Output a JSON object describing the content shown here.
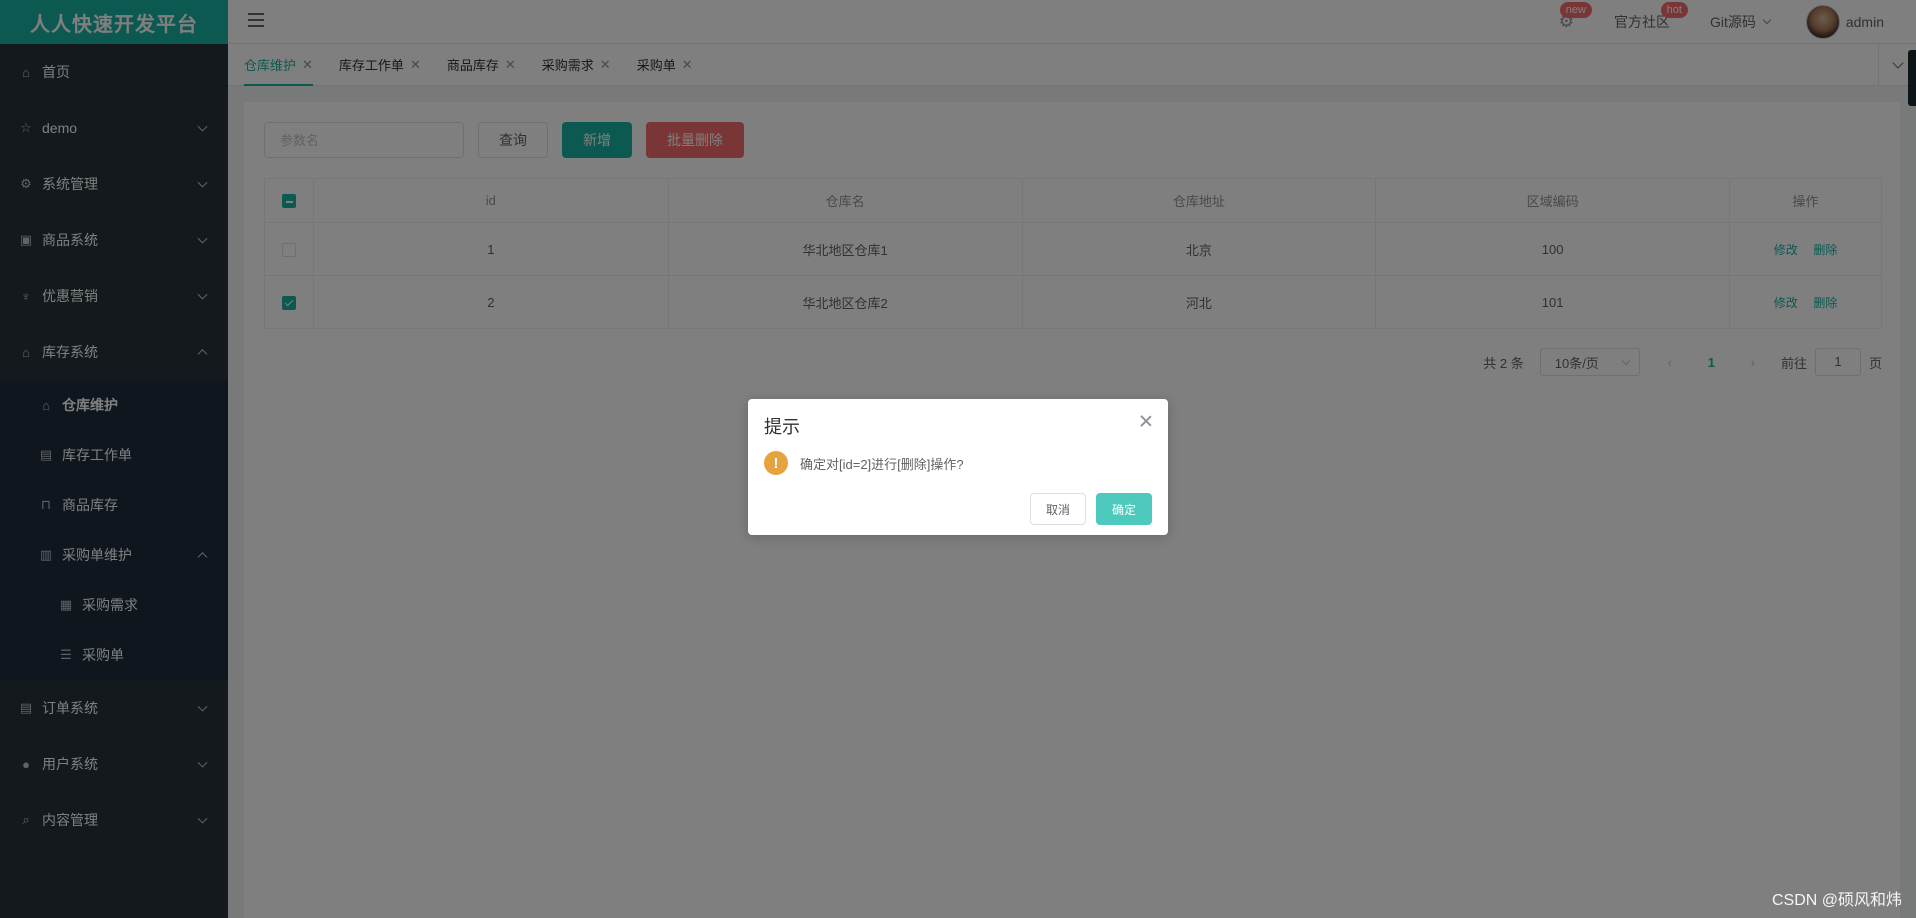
{
  "brand": "人人快速开发平台",
  "sidebar": {
    "items": [
      {
        "label": "首页",
        "icon": "home-icon"
      },
      {
        "label": "demo",
        "icon": "star-icon"
      },
      {
        "label": "系统管理",
        "icon": "gear-icon"
      },
      {
        "label": "商品系统",
        "icon": "box-icon"
      },
      {
        "label": "优惠营销",
        "icon": "coupon-icon"
      },
      {
        "label": "库存系统",
        "icon": "home-icon",
        "expanded": true
      }
    ],
    "inventory_sub": [
      {
        "label": "仓库维护",
        "icon": "home-icon",
        "active": true
      },
      {
        "label": "库存工作单",
        "icon": "document-icon"
      },
      {
        "label": "商品库存",
        "icon": "lock-icon"
      },
      {
        "label": "采购单维护",
        "icon": "bar-chart-icon",
        "expanded": true
      }
    ],
    "purchase_sub": [
      {
        "label": "采购需求",
        "icon": "grid-icon"
      },
      {
        "label": "采购单",
        "icon": "list-icon"
      }
    ],
    "bottom_items": [
      {
        "label": "订单系统",
        "icon": "document-icon"
      },
      {
        "label": "用户系统",
        "icon": "user-icon"
      },
      {
        "label": "内容管理",
        "icon": "search-icon"
      }
    ]
  },
  "navbar": {
    "settings_badge": "new",
    "community": "官方社区",
    "community_badge": "hot",
    "git": "Git源码",
    "user": "admin"
  },
  "tabs": [
    {
      "label": "仓库维护",
      "active": true
    },
    {
      "label": "库存工作单"
    },
    {
      "label": "商品库存"
    },
    {
      "label": "采购需求"
    },
    {
      "label": "采购单"
    }
  ],
  "toolbar": {
    "search_placeholder": "参数名",
    "query": "查询",
    "add": "新增",
    "batch_delete": "批量删除"
  },
  "table": {
    "columns": [
      "id",
      "仓库名",
      "仓库地址",
      "区域编码",
      "操作"
    ],
    "rows": [
      {
        "id": "1",
        "name": "华北地区仓库1",
        "address": "北京",
        "area_code": "100",
        "checked": false
      },
      {
        "id": "2",
        "name": "华北地区仓库2",
        "address": "河北",
        "area_code": "101",
        "checked": true
      }
    ],
    "edit": "修改",
    "delete": "删除"
  },
  "pagination": {
    "total": "共 2 条",
    "page_size": "10条/页",
    "prev": "‹",
    "current": "1",
    "next": "›",
    "goto": "前往",
    "goto_value": "1",
    "page_unit": "页"
  },
  "dialog": {
    "title": "提示",
    "message": "确定对[id=2]进行[删除]操作?",
    "cancel": "取消",
    "confirm": "确定"
  },
  "watermark": "CSDN @硕风和炜",
  "colors": {
    "accent": "#17b3a3",
    "danger": "#f56c6c",
    "warning": "#e6a23c",
    "sidebar": "#263238"
  }
}
